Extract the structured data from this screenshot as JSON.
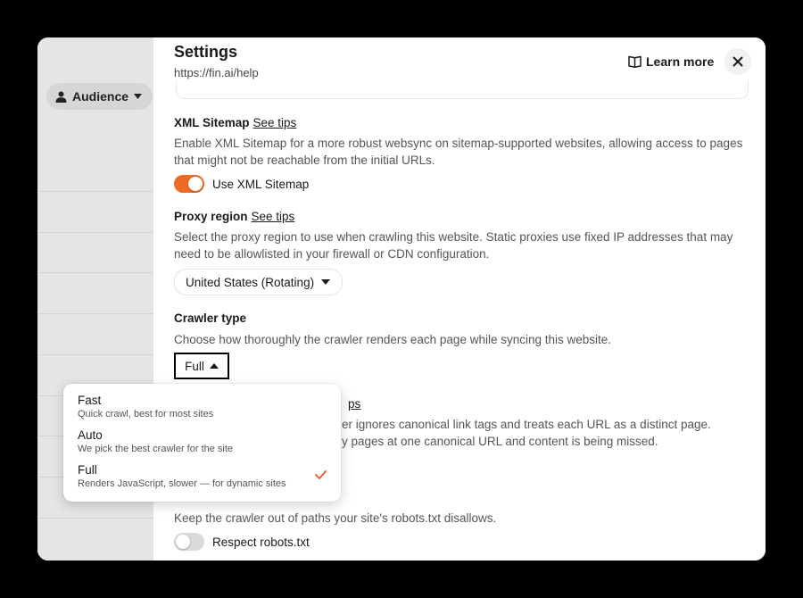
{
  "sidebar": {
    "audience_label": "Audience"
  },
  "panel": {
    "title": "Settings",
    "subtitle": "https://fin.ai/help",
    "learn_more": "Learn more"
  },
  "xml_sitemap": {
    "title": "XML Sitemap",
    "tips": "See tips",
    "description": "Enable XML Sitemap for a more robust websync on sitemap-supported websites, allowing access to pages that might not be reachable from the initial URLs.",
    "toggle_label": "Use XML Sitemap",
    "enabled": true
  },
  "proxy": {
    "title": "Proxy region",
    "tips": "See tips",
    "description": "Select the proxy region to use when crawling this website. Static proxies use fixed IP addresses that may need to be allowlisted in your firewall or CDN configuration.",
    "selected": "United States (Rotating)"
  },
  "crawler": {
    "title": "Crawler type",
    "description": "Choose how thoroughly the crawler renders each page while syncing this website.",
    "selected": "Full",
    "options": [
      {
        "label": "Fast",
        "sub": "Quick crawl, best for most sites"
      },
      {
        "label": "Auto",
        "sub": "We pick the best crawler for the site"
      },
      {
        "label": "Full",
        "sub": "Renders JavaScript, slower — for dynamic sites"
      }
    ]
  },
  "canonical": {
    "tips_fragment": "ps",
    "desc_line1": "er ignores canonical link tags and treats each URL as a distinct page.",
    "desc_line2": "y pages at one canonical URL and content is being missed."
  },
  "robots": {
    "description": "Keep the crawler out of paths your site's robots.txt disallows.",
    "toggle_label": "Respect robots.txt",
    "enabled": false
  },
  "colors": {
    "accent": "#ef6a26",
    "check": "#e8582a"
  }
}
